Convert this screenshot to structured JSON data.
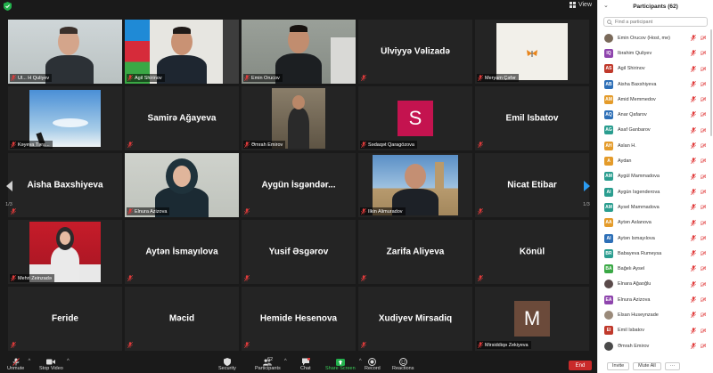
{
  "window": {
    "view_label": "View"
  },
  "tiles": [
    {
      "name": "",
      "caption": "Ul... H Quliyev",
      "type": "video",
      "scene": "host",
      "active": true
    },
    {
      "name": "",
      "caption": "Agil Shirinov",
      "type": "video",
      "scene": "flagman"
    },
    {
      "name": "",
      "caption": "Emin Orucov",
      "type": "video",
      "scene": "suitman"
    },
    {
      "name": "Ülviyyə Vəlizadə",
      "caption": "",
      "type": "name"
    },
    {
      "name": "",
      "caption": "Meryam Çəfər",
      "type": "video",
      "scene": "butterfly"
    },
    {
      "name": "",
      "caption": "Kəyeva Təra...",
      "type": "video",
      "scene": "sky"
    },
    {
      "name": "Samirə Ağayeva",
      "caption": "",
      "type": "name"
    },
    {
      "name": "",
      "caption": "Əmrah Emirov",
      "type": "video",
      "scene": "standing"
    },
    {
      "name": "",
      "caption": "Sədaqət Qaragözova",
      "type": "avatar",
      "letter": "S",
      "color": "#c4134f"
    },
    {
      "name": "Emil Isbatov",
      "caption": "",
      "type": "name"
    },
    {
      "name": "Aisha Baxshiyeva",
      "caption": "",
      "type": "name"
    },
    {
      "name": "",
      "caption": "Elnura Azizova",
      "type": "video",
      "scene": "hijab"
    },
    {
      "name": "Aygün İsgəndər...",
      "caption": "",
      "type": "name"
    },
    {
      "name": "",
      "caption": "Ilkin Alimuradov",
      "type": "video",
      "scene": "oldcity"
    },
    {
      "name": "Nicat Etibar",
      "caption": "",
      "type": "name"
    },
    {
      "name": "",
      "caption": "Mehri Zeinzadə",
      "type": "video",
      "scene": "redchair"
    },
    {
      "name": "Aytən İsmayılova",
      "caption": "",
      "type": "name"
    },
    {
      "name": "Yusif Əsgərov",
      "caption": "",
      "type": "name"
    },
    {
      "name": "Zarifa Aliyeva",
      "caption": "",
      "type": "name"
    },
    {
      "name": "Könül",
      "caption": "",
      "type": "name"
    },
    {
      "name": "Feride",
      "caption": "",
      "type": "name"
    },
    {
      "name": "Məcid",
      "caption": "",
      "type": "name"
    },
    {
      "name": "Hemide Hesenova",
      "caption": "",
      "type": "name"
    },
    {
      "name": "Xudiyev Mirsadiq",
      "caption": "",
      "type": "name"
    },
    {
      "name": "",
      "caption": "Mirsiddiqə Zekiyeva",
      "type": "avatar",
      "letter": "M",
      "color": "#6b4a3a"
    }
  ],
  "pages": {
    "left": "1/3",
    "right": "1/3"
  },
  "toolbar": {
    "unmute": "Unmute",
    "stop_video": "Stop Video",
    "security": "Security",
    "participants": "Participants",
    "participants_count": "62",
    "chat": "Chat",
    "share_screen": "Share Screen",
    "record": "Record",
    "reactions": "Reactions",
    "end": "End"
  },
  "panel": {
    "title": "Participants (62)",
    "search_placeholder": "Find a participant",
    "participants": [
      {
        "name": "Emin Orucov (Host, me)",
        "initials": "",
        "color": "#7a6a5a",
        "photo": true
      },
      {
        "name": "Ibrahim Quliyev",
        "initials": "IQ",
        "color": "#8e44ad"
      },
      {
        "name": "Agil Shirinov",
        "initials": "AS",
        "color": "#c0392b"
      },
      {
        "name": "Aisha Baxshiyeva",
        "initials": "AB",
        "color": "#2d6fb7"
      },
      {
        "name": "Amid Memmedov",
        "initials": "AM",
        "color": "#e49b2a"
      },
      {
        "name": "Anar Qafarov",
        "initials": "AQ",
        "color": "#2d6fb7"
      },
      {
        "name": "Asaf Ganbarov",
        "initials": "AG",
        "color": "#2a9d8f"
      },
      {
        "name": "Aslan H.",
        "initials": "AH",
        "color": "#e49b2a"
      },
      {
        "name": "Aydan",
        "initials": "A",
        "color": "#e49b2a"
      },
      {
        "name": "Aygül Mammadova",
        "initials": "AM",
        "color": "#2a9d8f"
      },
      {
        "name": "Aygün Isgenderova",
        "initials": "AI",
        "color": "#2a9d8f"
      },
      {
        "name": "Aysel Mammadova",
        "initials": "AM",
        "color": "#2a9d8f"
      },
      {
        "name": "Aytən Aslanova",
        "initials": "AA",
        "color": "#e49b2a"
      },
      {
        "name": "Aytən Ismayılova",
        "initials": "AI",
        "color": "#2d6fb7"
      },
      {
        "name": "Babayeva Rumeysa",
        "initials": "BR",
        "color": "#2a9d8f"
      },
      {
        "name": "Bağelı Aysel",
        "initials": "BA",
        "color": "#3aa845"
      },
      {
        "name": "Elnara Ağaoğlu",
        "initials": "",
        "color": "#5a4a4a",
        "photo": true
      },
      {
        "name": "Elnura Azizova",
        "initials": "EA",
        "color": "#8e44ad"
      },
      {
        "name": "Elsan Huseynzade",
        "initials": "",
        "color": "#9a8a7a",
        "photo": true
      },
      {
        "name": "Emil Isbatov",
        "initials": "EI",
        "color": "#c0392b"
      },
      {
        "name": "Əmrah Emirov",
        "initials": "",
        "color": "#4a4a4a",
        "photo": true
      }
    ],
    "invite": "Invite",
    "mute_all": "Mute All"
  }
}
